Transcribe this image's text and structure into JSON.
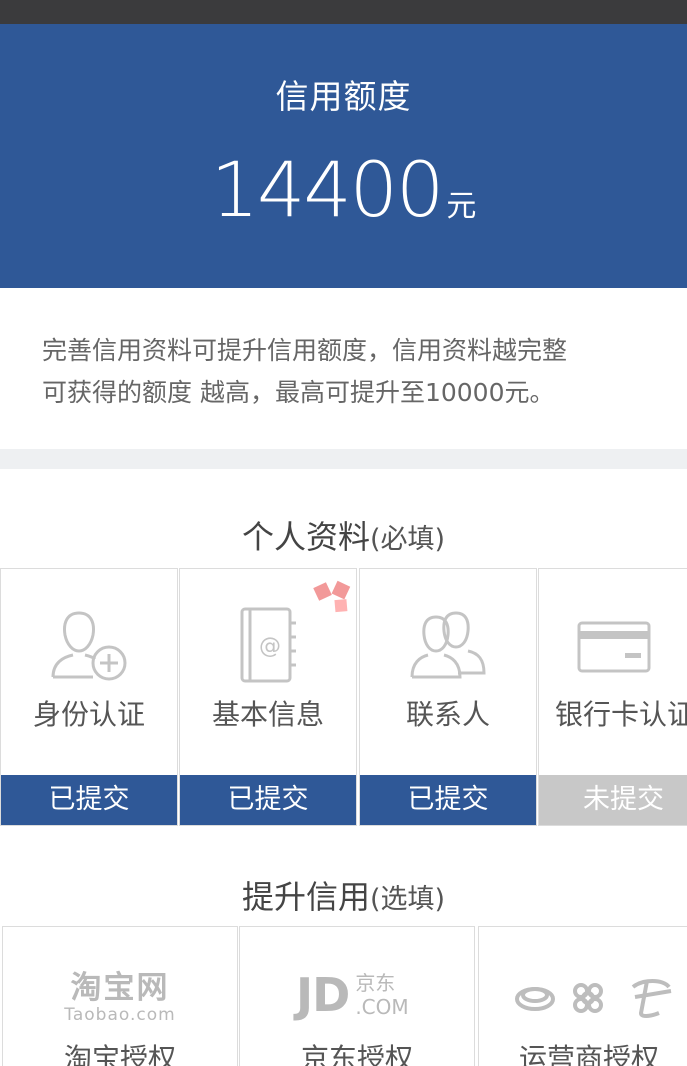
{
  "hero": {
    "title": "信用额度",
    "amount": "14400",
    "unit": "元"
  },
  "description": {
    "line1": "完善信用资料可提升信用额度，信用资料越完整",
    "line2": "可获得的额度 越高，最高可提升至10000元。"
  },
  "personal_section": {
    "title": "个人资料",
    "subtitle": "(必填)",
    "items": [
      {
        "label": "身份认证",
        "status": "已提交",
        "icon": "user-add-icon",
        "submitted": true
      },
      {
        "label": "基本信息",
        "status": "已提交",
        "icon": "address-book-icon",
        "submitted": true
      },
      {
        "label": "联系人",
        "status": "已提交",
        "icon": "contacts-icon",
        "submitted": true
      },
      {
        "label": "银行卡认证",
        "status": "未提交",
        "icon": "bank-card-icon",
        "submitted": false
      }
    ]
  },
  "boost_section": {
    "title": "提升信用",
    "subtitle": "(选填)",
    "items": [
      {
        "label": "淘宝授权",
        "logo_text": "淘宝网",
        "logo_sub": "Taobao.com",
        "icon": "taobao-logo-icon"
      },
      {
        "label": "京东授权",
        "logo_text": "JD",
        "logo_cn": "京东",
        "logo_sub": ".COM",
        "icon": "jd-logo-icon"
      },
      {
        "label": "运营商授权",
        "icon": "carrier-logos-icon"
      }
    ]
  },
  "colors": {
    "primary": "#2f5897",
    "pending": "#c8c8c8",
    "status_bar": "#3b3b3d"
  }
}
